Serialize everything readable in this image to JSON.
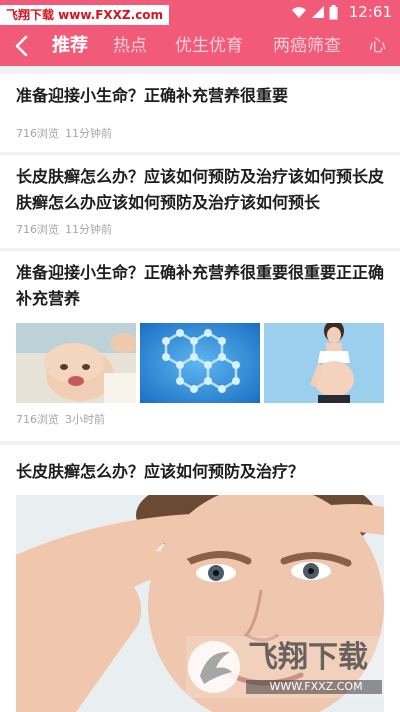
{
  "status_bar": {
    "watermark_text": "飞翔下载 www.FXXZ.com",
    "time": "12:61"
  },
  "nav": {
    "tabs": [
      {
        "label": "推荐",
        "active": true
      },
      {
        "label": "热点",
        "active": false
      },
      {
        "label": "优生优育",
        "active": false
      },
      {
        "label": "两癌筛查",
        "active": false
      },
      {
        "label": "心",
        "active": false
      }
    ]
  },
  "feed": {
    "articles": [
      {
        "title": "准备迎接小生命？正确补充营养很重要",
        "views": "716浏览",
        "time": "11分钟前"
      },
      {
        "title": "长皮肤癣怎么办？应该如何预防及治疗该如何预长皮肤癣怎么办应该如何预防及治疗该如何预长",
        "views": "716浏览",
        "time": "11分钟前"
      },
      {
        "title": "准备迎接小生命？正确补充营养很重要很重要正正确补充营养",
        "views": "716浏览",
        "time": "3小时前",
        "thumbnails": [
          "baby-photo",
          "molecule-photo",
          "pregnant-woman-photo"
        ]
      },
      {
        "title": "长皮肤癣怎么办？应该如何预防及治疗？",
        "image": "child-face-photo"
      }
    ]
  },
  "watermark": {
    "brand_text": "飞翔下载",
    "url_text": "WWW.FXXZ.COM"
  },
  "colors": {
    "header_bg": "#f25a7a",
    "page_bg": "#f2f2f2",
    "title_text": "#1d1d1d",
    "meta_text": "#a5a5a5"
  }
}
